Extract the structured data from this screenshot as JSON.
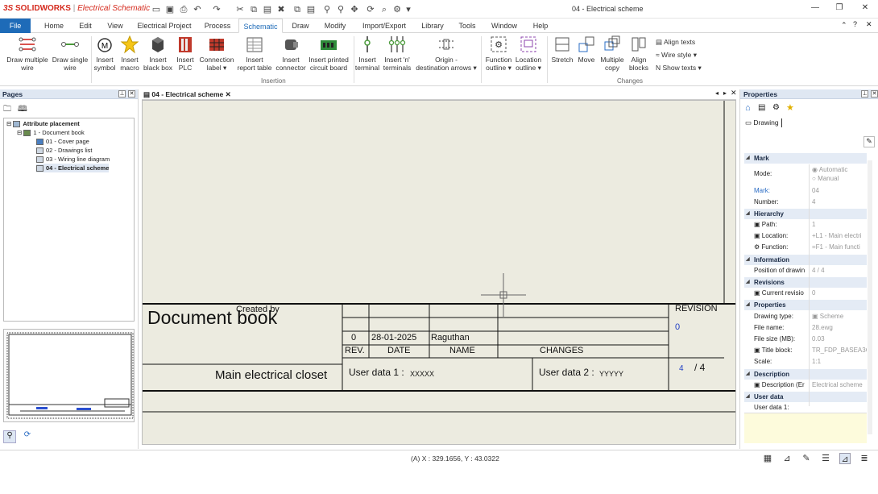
{
  "app": {
    "brand_ds": "3S",
    "brand_name": "SOLIDWORKS",
    "brand_sep": "|",
    "brand_product": "Electrical Schematic",
    "window_title": "04 - Electrical scheme"
  },
  "menu": [
    "File",
    "Home",
    "Edit",
    "View",
    "Electrical Project",
    "Process",
    "Schematic",
    "Draw",
    "Modify",
    "Import/Export",
    "Library",
    "Tools",
    "Window",
    "Help"
  ],
  "ribbon": {
    "buttons": [
      {
        "label1": "Draw multiple",
        "label2": "wire"
      },
      {
        "label1": "Draw single",
        "label2": "wire"
      },
      {
        "label1": "Insert",
        "label2": "symbol"
      },
      {
        "label1": "Insert",
        "label2": "macro"
      },
      {
        "label1": "Insert",
        "label2": "black box"
      },
      {
        "label1": "Insert",
        "label2": "PLC"
      },
      {
        "label1": "Connection",
        "label2": "label"
      },
      {
        "label1": "Insert",
        "label2": "report table"
      },
      {
        "label1": "Insert",
        "label2": "connector"
      },
      {
        "label1": "Insert printed",
        "label2": "circuit board"
      },
      {
        "label1": "Insert",
        "label2": "terminal"
      },
      {
        "label1": "Insert 'n'",
        "label2": "terminals"
      },
      {
        "label1": "Origin -",
        "label2": "destination arrows"
      },
      {
        "label1": "Function",
        "label2": "outline"
      },
      {
        "label1": "Location",
        "label2": "outline"
      },
      {
        "label1": "Stretch",
        "label2": ""
      },
      {
        "label1": "Move",
        "label2": ""
      },
      {
        "label1": "Multiple",
        "label2": "copy"
      },
      {
        "label1": "Align",
        "label2": "blocks"
      }
    ],
    "small": [
      "Align texts",
      "Wire style",
      "Show texts"
    ],
    "group_insertion": "Insertion",
    "group_changes": "Changes"
  },
  "pages_panel": {
    "title": "Pages",
    "tree": [
      {
        "label": "Attribute placement",
        "level": 0,
        "bold": true
      },
      {
        "label": "1 - Document book",
        "level": 1,
        "bold": false
      },
      {
        "label": "01 - Cover page",
        "level": 2,
        "bold": false
      },
      {
        "label": "02 - Drawings list",
        "level": 2,
        "bold": false
      },
      {
        "label": "03 - Wiring line diagram",
        "level": 2,
        "bold": false
      },
      {
        "label": "04 - Electrical scheme",
        "level": 2,
        "bold": true
      }
    ]
  },
  "doc_tab": {
    "label": "04 - Electrical scheme"
  },
  "title_block": {
    "doc_title": "Document book",
    "created_by": "Created by",
    "rev_value": "0",
    "date_value": "28-01-2025",
    "name_value": "Raguthan",
    "rev_header": "REV.",
    "date_header": "DATE",
    "name_header": "NAME",
    "changes_header": "CHANGES",
    "revision_label": "REVISION",
    "revision_value": "0",
    "location": "Main electrical closet",
    "user_data1_label": "User data 1  :",
    "user_data1_value": "XXXXX",
    "user_data2_label": "User data 2  :",
    "user_data2_value": "YYYYY",
    "page_num": "4",
    "page_total": "/ 4"
  },
  "properties": {
    "title": "Properties",
    "drawing_tab": "Drawing",
    "sections": {
      "mark": "Mark",
      "hierarchy": "Hierarchy",
      "information": "Information",
      "revisions": "Revisions",
      "properties": "Properties",
      "description": "Description",
      "user_data": "User data"
    },
    "rows": {
      "mode_label": "Mode:",
      "mode_auto": "Automatic",
      "mode_manual": "Manual",
      "mark_label": "Mark:",
      "mark_value": "04",
      "number_label": "Number:",
      "number_value": "4",
      "path_label": "Path:",
      "path_value": "1",
      "location_label": "Location:",
      "location_value": "+L1 - Main electri",
      "function_label": "Function:",
      "function_value": "=F1 - Main functi",
      "position_label": "Position of drawin",
      "position_value": "4 / 4",
      "current_rev_label": "Current revisio",
      "current_rev_value": "0",
      "drawing_type_label": "Drawing type:",
      "drawing_type_value": "Scheme",
      "file_name_label": "File name:",
      "file_name_value": "28.ewg",
      "file_size_label": "File size (MB):",
      "file_size_value": "0.03",
      "title_block_label": "Title block:",
      "title_block_value": "TR_FDP_BASEA3C",
      "scale_label": "Scale:",
      "scale_value": "1:1",
      "desc_label": "Description (Er",
      "desc_value": "Electrical scheme",
      "user_data1_label": "User data 1:"
    }
  },
  "status": {
    "coords": "(A) X : 329.1656, Y : 43.0322"
  }
}
